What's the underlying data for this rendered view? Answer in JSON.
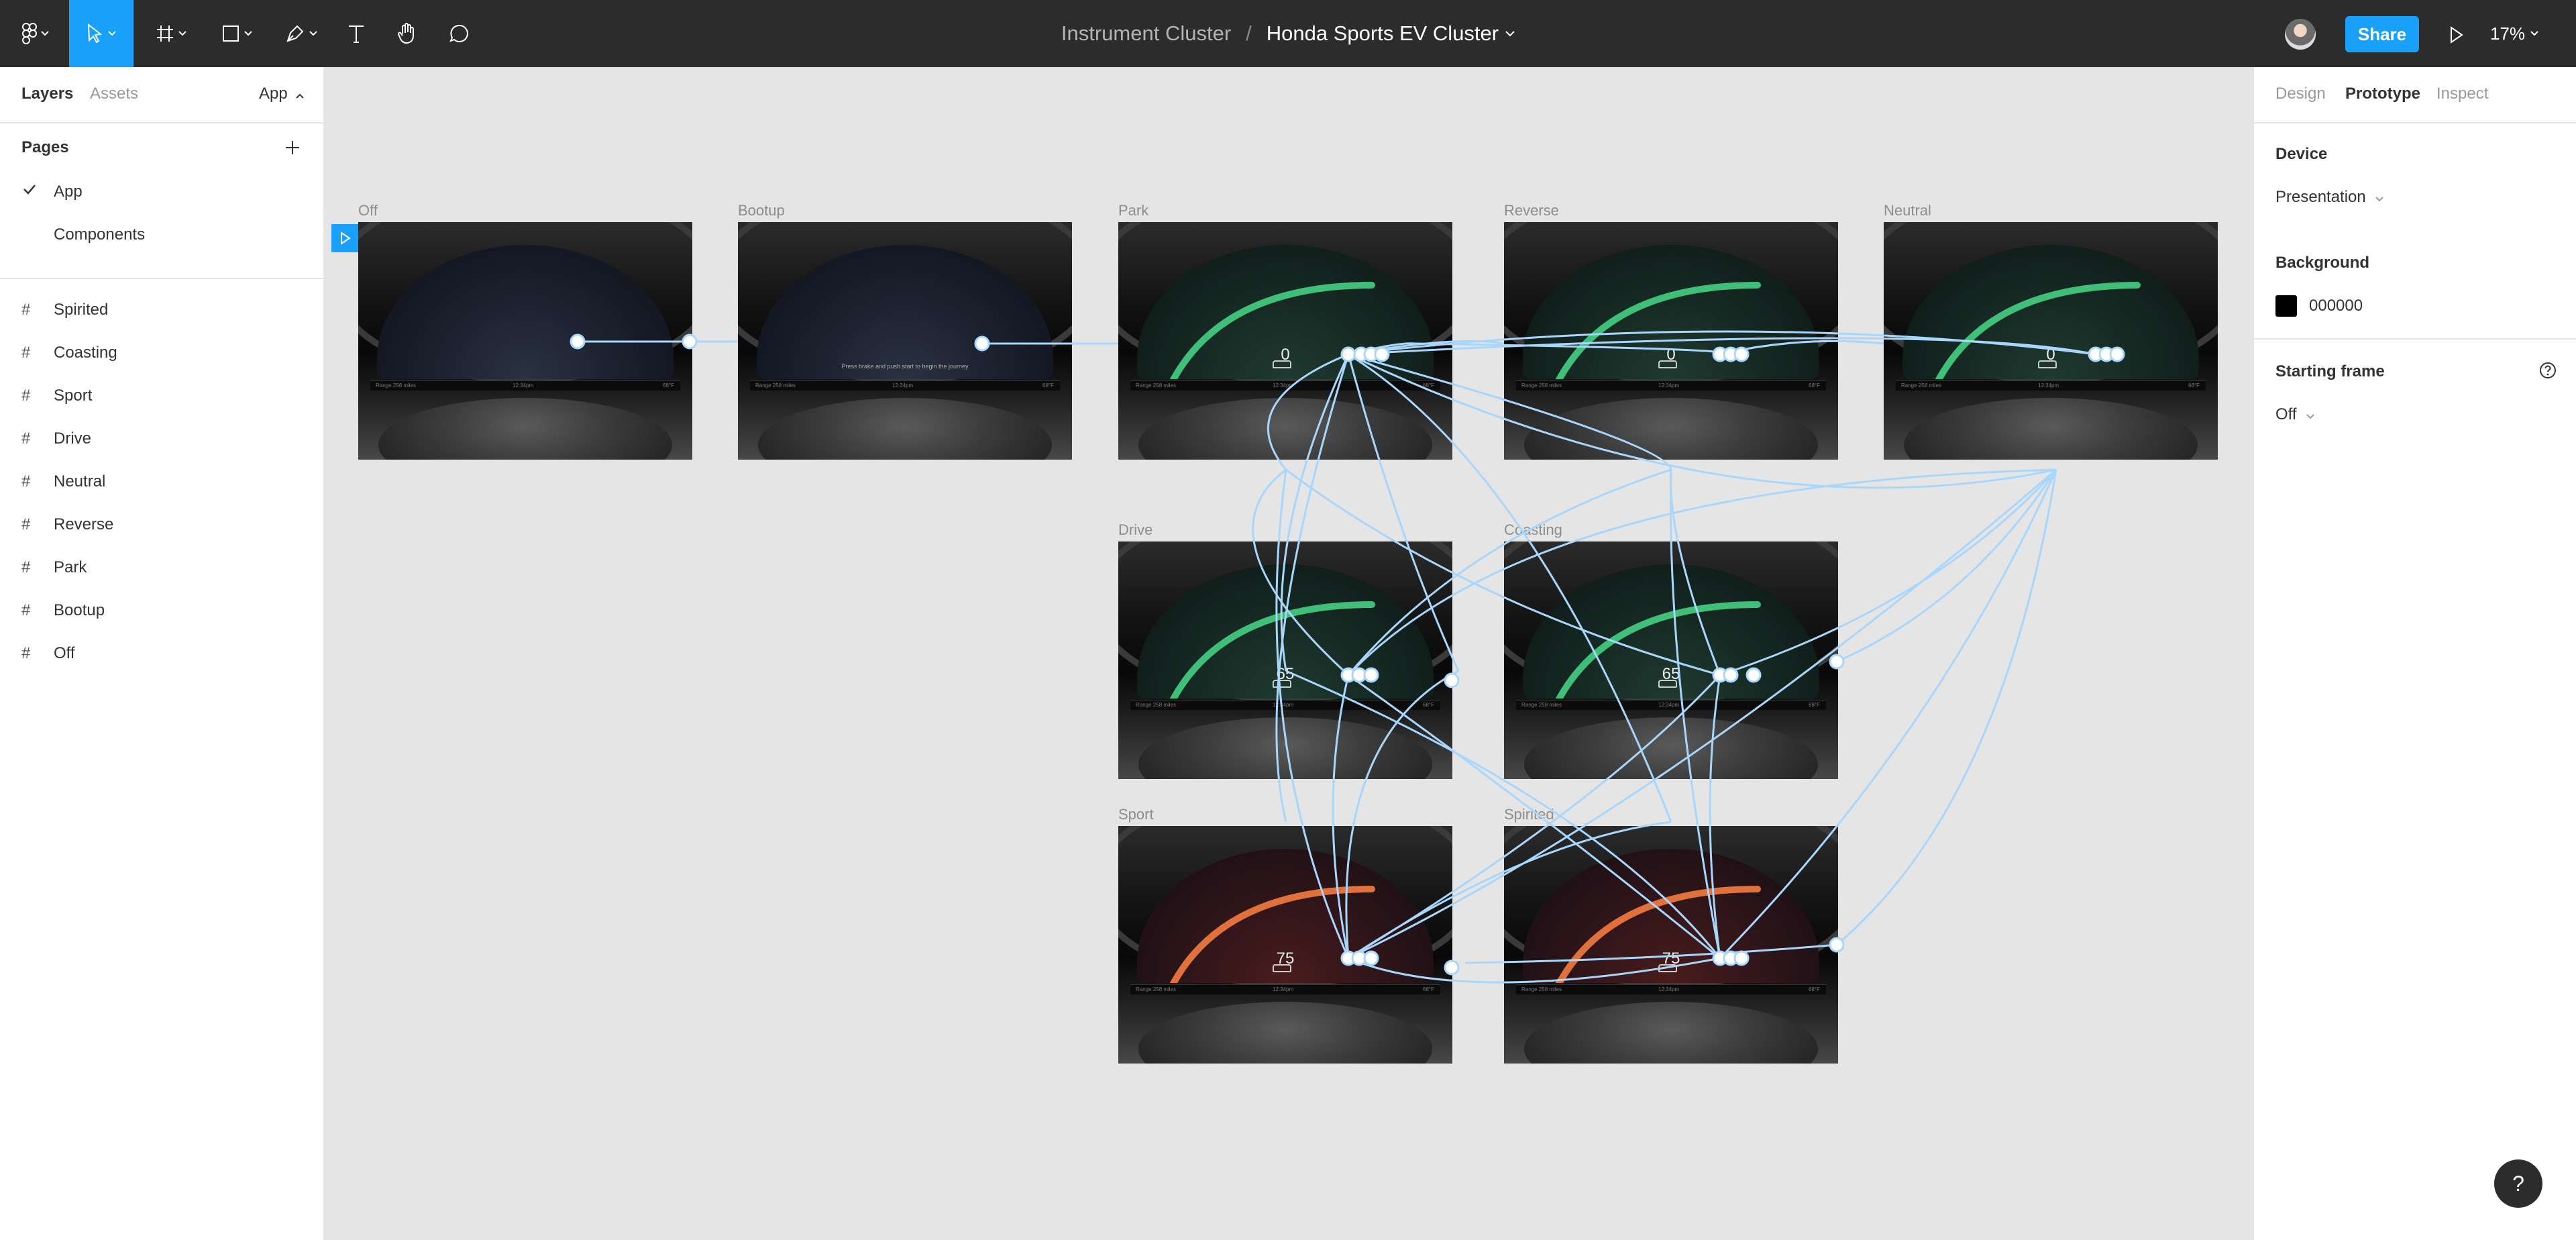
{
  "toolbar": {
    "project": "Instrument Cluster",
    "separator": "/",
    "file_name": "Honda Sports EV Cluster",
    "share_label": "Share",
    "zoom": "17%",
    "tools": [
      "main-menu",
      "move",
      "frame",
      "rectangle",
      "pen",
      "text",
      "hand",
      "comment"
    ]
  },
  "left_panel": {
    "tabs": [
      "Layers",
      "Assets"
    ],
    "page_switch": "App",
    "pages_header": "Pages",
    "pages": [
      {
        "label": "App",
        "selected": true
      },
      {
        "label": "Components",
        "selected": false
      }
    ],
    "layers": [
      "Spirited",
      "Coasting",
      "Sport",
      "Drive",
      "Neutral",
      "Reverse",
      "Park",
      "Bootup",
      "Off"
    ]
  },
  "right_panel": {
    "tabs": [
      "Design",
      "Prototype",
      "Inspect"
    ],
    "active_tab": "Prototype",
    "device_title": "Device",
    "device_value": "Presentation",
    "background_title": "Background",
    "background_hex": "000000",
    "starting_frame_title": "Starting frame",
    "starting_frame_value": "Off"
  },
  "canvas": {
    "frames": [
      {
        "name": "Off",
        "speed": "",
        "mode": "blank"
      },
      {
        "name": "Bootup",
        "speed": "",
        "mode": "boot",
        "prompt": "Press brake and push start to begin the journey"
      },
      {
        "name": "Park",
        "speed": "0",
        "mode": "green"
      },
      {
        "name": "Reverse",
        "speed": "0",
        "mode": "green"
      },
      {
        "name": "Neutral",
        "speed": "0",
        "mode": "green"
      },
      {
        "name": "Drive",
        "speed": "65",
        "mode": "green"
      },
      {
        "name": "Coasting",
        "speed": "65",
        "mode": "green"
      },
      {
        "name": "Sport",
        "speed": "75",
        "mode": "red"
      },
      {
        "name": "Spirited",
        "speed": "75",
        "mode": "red"
      }
    ],
    "cluster_bar": {
      "left": "Range 258 miles",
      "center": "12:34pm",
      "right": "68°F"
    },
    "connection_color": "#a9d6fb"
  },
  "help_label": "?"
}
